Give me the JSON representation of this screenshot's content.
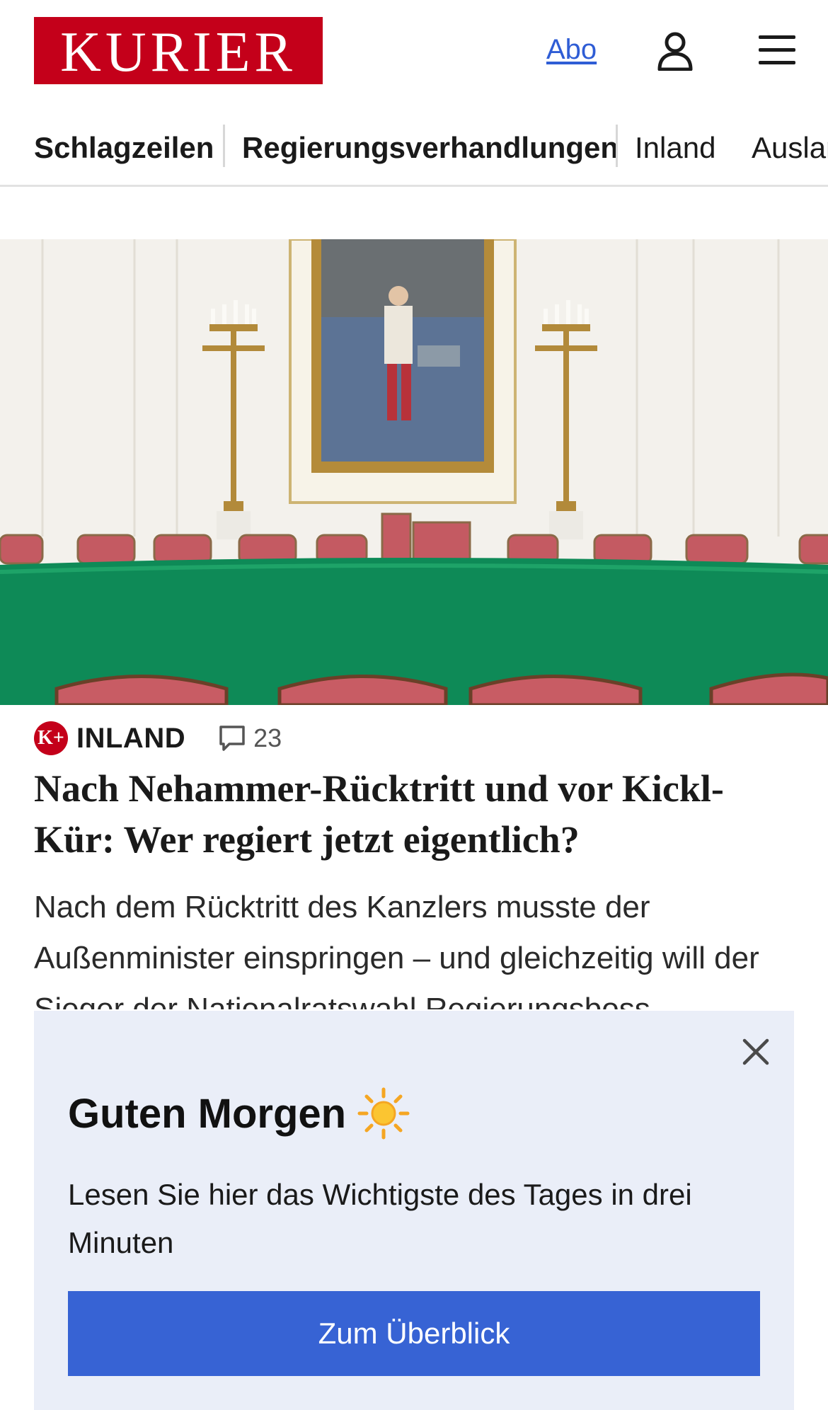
{
  "header": {
    "logo_text": "KURIER",
    "abo_label": "Abo",
    "brand_color": "#c4001a",
    "user_icon": "user-icon",
    "menu_icon": "hamburger-menu-icon"
  },
  "nav": {
    "items": [
      {
        "label": "Schlagzeilen"
      },
      {
        "label": "Regierungsverhandlungen"
      },
      {
        "label": "Inland"
      },
      {
        "label": "Ausland"
      }
    ]
  },
  "article": {
    "hero_image": "painting-in-council-chamber-with-green-table",
    "badge": "K+",
    "section": "INLAND",
    "comment_icon": "comment-icon",
    "comment_count": "23",
    "headline": "Nach Nehammer-Rücktritt und vor Kickl-Kür: Wer regiert jetzt eigentlich?",
    "teaser": "Nach dem Rücktritt des Kanzlers musste der Außenminister einspringen – und gleichzeitig will der Sieger der Nationalratswahl Regierungsboss"
  },
  "overlay": {
    "title": "Guten Morgen",
    "title_icon": "sun-icon",
    "text": "Lesen Sie hier das Wichtigste des Tages in drei Minuten",
    "button_label": "Zum Überblick",
    "close_icon": "close-icon",
    "background_color": "#eaeef8",
    "button_color": "#3763d4"
  }
}
